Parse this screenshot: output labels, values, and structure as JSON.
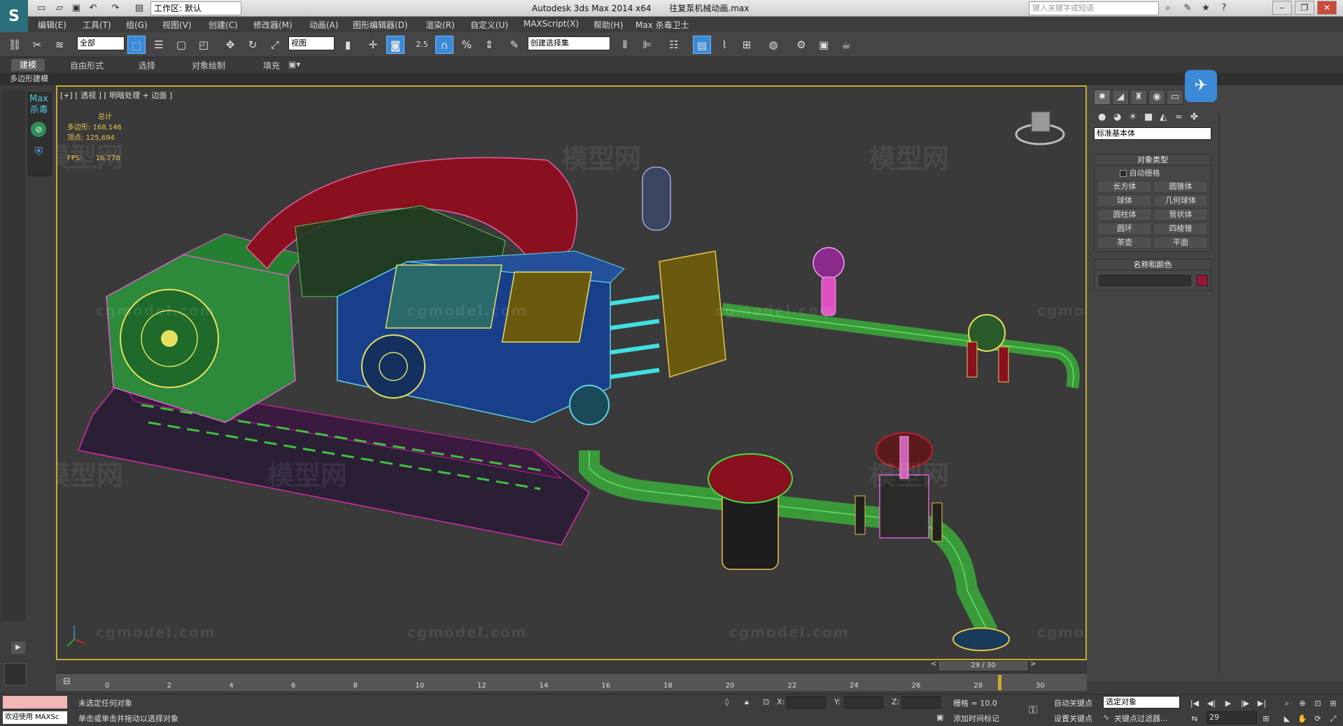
{
  "window": {
    "app_title": "Autodesk 3ds Max  2014 x64",
    "file_name": "往复泵机械动画.max",
    "workspace": "工作区: 默认",
    "search_placeholder": "键入关键字或短语"
  },
  "menu": [
    "编辑(E)",
    "工具(T)",
    "组(G)",
    "视图(V)",
    "创建(C)",
    "修改器(M)",
    "动画(A)",
    "图形编辑器(D)",
    "渲染(R)",
    "自定义(U)",
    "MAXScript(X)",
    "帮助(H)",
    "Max 杀毒卫士"
  ],
  "toolbar": {
    "filter_select": "全部",
    "ref_coord": "视图",
    "snap_value": "2.5",
    "named_selection": "创建选择集"
  },
  "ribbon": {
    "tabs": [
      "建模",
      "自由形式",
      "选择",
      "对象绘制",
      "填充"
    ],
    "sub_label": "多边形建模"
  },
  "left_strip": {
    "max_av_line1": "Max",
    "max_av_line2": "杀毒"
  },
  "viewport": {
    "label": "[+] [ 透视 ] [ 明暗处理 + 边面 ]",
    "stats_header": "总计",
    "polygons_label": "多边形:",
    "polygons_value": "168,146",
    "vertices_label": "顶点:",
    "vertices_value": "125,694",
    "fps_label": "FPS:",
    "fps_value": "16.778",
    "watermark_cn": "模型网",
    "watermark_en": "cgmodel.com"
  },
  "command_panel": {
    "category_select": "标准基本体",
    "object_type_header": "对象类型",
    "auto_grid_label": "自动栅格",
    "primitives": [
      "长方体",
      "圆锥体",
      "球体",
      "几何球体",
      "圆柱体",
      "管状体",
      "圆环",
      "四棱锥",
      "茶壶",
      "平面"
    ],
    "name_color_header": "名称和颜色",
    "object_color": "#9a1535"
  },
  "timeline": {
    "frame_display": "29 / 30",
    "ticks": [
      "0",
      "2",
      "4",
      "6",
      "8",
      "10",
      "12",
      "14",
      "16",
      "18",
      "20",
      "22",
      "24",
      "26",
      "28",
      "30"
    ],
    "current_frame": 29,
    "total_frames": 30
  },
  "status": {
    "maxscript_label": "欢迎使用 MAXSc",
    "line1": "未选定任何对象",
    "line2": "单击或单击并拖动以选择对象",
    "x_label": "X:",
    "y_label": "Y:",
    "z_label": "Z:",
    "grid_label": "栅格 = 10.0",
    "add_time_tag": "添加时间标记",
    "auto_key": "自动关键点",
    "set_key": "设置关键点",
    "key_mode_select": "选定对象",
    "key_filters": "关键点过滤器...",
    "frame_input": "29"
  },
  "colors": {
    "viewport_border": "#c8a832",
    "active_tool": "#3a8ad8",
    "bg": "#3d3d3d"
  }
}
